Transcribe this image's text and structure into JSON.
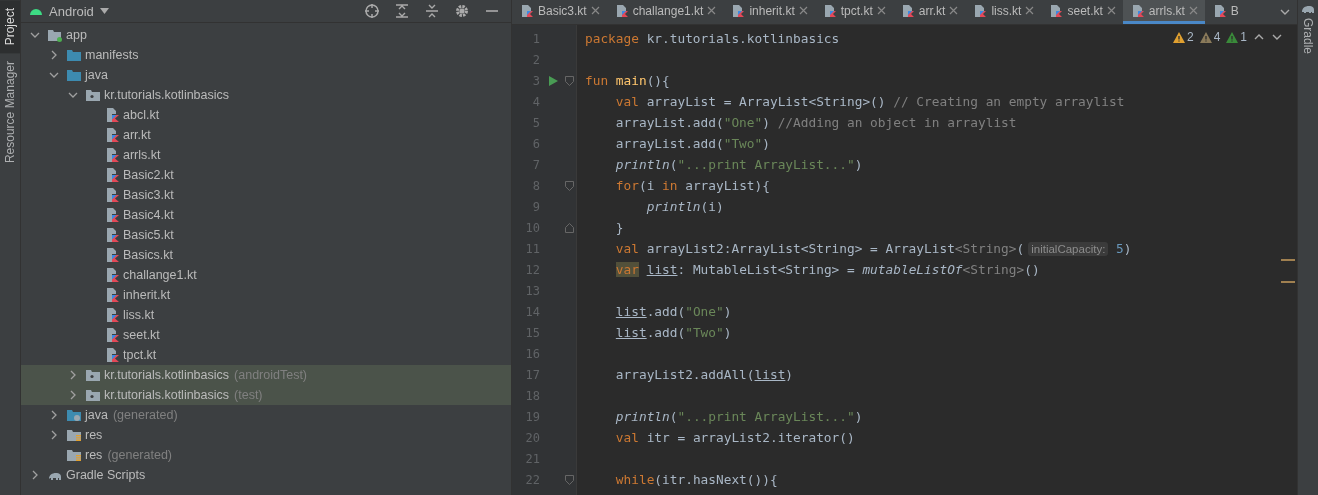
{
  "side_tabs": [
    {
      "label": "Project",
      "selected": true
    },
    {
      "label": "Resource Manager",
      "selected": false
    }
  ],
  "project_panel": {
    "view": "Android"
  },
  "tree": [
    {
      "label": "app",
      "kind": "module",
      "expanded": true,
      "selected": false,
      "children": [
        {
          "label": "manifests",
          "kind": "folder",
          "expanded": false,
          "selected": false
        },
        {
          "label": "java",
          "kind": "folder",
          "expanded": true,
          "selected": false,
          "children": [
            {
              "label": "kr.tutorials.kotlinbasics",
              "kind": "package",
              "expanded": true,
              "selected": false,
              "children": [
                {
                  "label": "abcl.kt",
                  "kind": "kotlin",
                  "selected": false
                },
                {
                  "label": "arr.kt",
                  "kind": "kotlin",
                  "selected": false
                },
                {
                  "label": "arrls.kt",
                  "kind": "kotlin",
                  "selected": false
                },
                {
                  "label": "Basic2.kt",
                  "kind": "kotlin",
                  "selected": false
                },
                {
                  "label": "Basic3.kt",
                  "kind": "kotlin",
                  "selected": false
                },
                {
                  "label": "Basic4.kt",
                  "kind": "kotlin",
                  "selected": false
                },
                {
                  "label": "Basic5.kt",
                  "kind": "kotlin",
                  "selected": false
                },
                {
                  "label": "Basics.kt",
                  "kind": "kotlin",
                  "selected": false
                },
                {
                  "label": "challange1.kt",
                  "kind": "kotlin",
                  "selected": false
                },
                {
                  "label": "inherit.kt",
                  "kind": "kotlin",
                  "selected": false
                },
                {
                  "label": "liss.kt",
                  "kind": "kotlin",
                  "selected": false
                },
                {
                  "label": "seet.kt",
                  "kind": "kotlin",
                  "selected": false
                },
                {
                  "label": "tpct.kt",
                  "kind": "kotlin",
                  "selected": false
                }
              ]
            },
            {
              "label": "kr.tutorials.kotlinbasics",
              "suffix": "(androidTest)",
              "kind": "package",
              "expanded": false,
              "selected": true
            },
            {
              "label": "kr.tutorials.kotlinbasics",
              "suffix": "(test)",
              "kind": "package",
              "expanded": false,
              "selected": true
            }
          ]
        },
        {
          "label": "java",
          "suffix": "(generated)",
          "kind": "generated",
          "expanded": false,
          "selected": false
        },
        {
          "label": "res",
          "kind": "res",
          "expanded": false,
          "selected": false
        },
        {
          "label": "res",
          "suffix": "(generated)",
          "kind": "res",
          "selected": false
        }
      ]
    },
    {
      "label": "Gradle Scripts",
      "kind": "gradle",
      "expanded": false,
      "selected": false
    }
  ],
  "tabs": [
    {
      "label": "Basic3.kt",
      "selected": false,
      "closable": true
    },
    {
      "label": "challange1.kt",
      "selected": false,
      "closable": true
    },
    {
      "label": "inherit.kt",
      "selected": false,
      "closable": true
    },
    {
      "label": "tpct.kt",
      "selected": false,
      "closable": true
    },
    {
      "label": "arr.kt",
      "selected": false,
      "closable": true
    },
    {
      "label": "liss.kt",
      "selected": false,
      "closable": true
    },
    {
      "label": "seet.kt",
      "selected": false,
      "closable": true
    },
    {
      "label": "arrls.kt",
      "selected": true,
      "closable": true
    },
    {
      "label": "B",
      "selected": false,
      "closable": false
    }
  ],
  "inspections": [
    {
      "kind": "warning",
      "count": "2"
    },
    {
      "kind": "weak",
      "count": "4"
    },
    {
      "kind": "ok",
      "count": "1"
    }
  ],
  "right_tabs": [
    {
      "label": "Gradle",
      "selected": false
    }
  ],
  "lines": [
    {
      "number": "1",
      "kind": "code",
      "tokens": [
        {
          "kind": "keyword",
          "text": "package "
        },
        {
          "kind": "plain",
          "text": "kr.tutorials.kotlinbasics"
        }
      ]
    },
    {
      "number": "2",
      "kind": "code"
    },
    {
      "number": "3",
      "kind": "entry",
      "tokens": [
        {
          "kind": "keyword",
          "text": "fun "
        },
        {
          "kind": "function",
          "text": "main"
        },
        {
          "kind": "plain",
          "text": "(){"
        }
      ]
    },
    {
      "number": "4",
      "kind": "code",
      "tokens": [
        {
          "kind": "keyword",
          "text": "    val "
        },
        {
          "kind": "plain",
          "text": "arrayList = ArrayList<String>() "
        },
        {
          "kind": "comment",
          "text": "// Creating an empty arraylist"
        }
      ]
    },
    {
      "number": "5",
      "kind": "code",
      "tokens": [
        {
          "kind": "plain",
          "text": "    arrayList.add("
        },
        {
          "kind": "string",
          "text": "\"One\""
        },
        {
          "kind": "plain",
          "text": ") "
        },
        {
          "kind": "comment",
          "text": "//Adding an object in arraylist"
        }
      ]
    },
    {
      "number": "6",
      "kind": "code",
      "tokens": [
        {
          "kind": "plain",
          "text": "    arrayList.add("
        },
        {
          "kind": "string",
          "text": "\"Two\""
        },
        {
          "kind": "plain",
          "text": ")"
        }
      ]
    },
    {
      "number": "7",
      "kind": "code",
      "tokens": [
        {
          "kind": "call",
          "text": "    println"
        },
        {
          "kind": "plain",
          "text": "("
        },
        {
          "kind": "string",
          "text": "\"...print ArrayList...\""
        },
        {
          "kind": "plain",
          "text": ")"
        }
      ]
    },
    {
      "number": "8",
      "kind": "fold-start",
      "tokens": [
        {
          "kind": "keyword",
          "text": "    for"
        },
        {
          "kind": "plain",
          "text": "(i "
        },
        {
          "kind": "keyword",
          "text": "in "
        },
        {
          "kind": "plain",
          "text": "arrayList){"
        }
      ]
    },
    {
      "number": "9",
      "kind": "code",
      "tokens": [
        {
          "kind": "call",
          "text": "        println"
        },
        {
          "kind": "plain",
          "text": "(i)"
        }
      ]
    },
    {
      "number": "10",
      "kind": "fold-end",
      "tokens": [
        {
          "kind": "plain",
          "text": "    }"
        }
      ]
    },
    {
      "number": "11",
      "kind": "code",
      "tokens": [
        {
          "kind": "keyword",
          "text": "    val "
        },
        {
          "kind": "plain",
          "text": "arrayList2:ArrayList<String> = ArrayList"
        },
        {
          "kind": "type",
          "text": "<String>"
        },
        {
          "kind": "plain",
          "text": "("
        },
        {
          "kind": "hint",
          "text": "initialCapacity:"
        },
        {
          "kind": "number",
          "text": " 5"
        },
        {
          "kind": "plain",
          "text": ")"
        }
      ]
    },
    {
      "number": "12",
      "kind": "code",
      "tokens": [
        {
          "kind": "keyword-marked",
          "text": "    var"
        },
        {
          "kind": "variable",
          "text": " list"
        },
        {
          "kind": "plain",
          "text": ": MutableList<String> = "
        },
        {
          "kind": "call",
          "text": "mutableListOf"
        },
        {
          "kind": "type",
          "text": "<String>"
        },
        {
          "kind": "plain",
          "text": "()"
        }
      ]
    },
    {
      "number": "13",
      "kind": "code"
    },
    {
      "number": "14",
      "kind": "code",
      "tokens": [
        {
          "kind": "variable",
          "text": "    list"
        },
        {
          "kind": "plain",
          "text": ".add("
        },
        {
          "kind": "string",
          "text": "\"One\""
        },
        {
          "kind": "plain",
          "text": ")"
        }
      ]
    },
    {
      "number": "15",
      "kind": "code",
      "tokens": [
        {
          "kind": "variable",
          "text": "    list"
        },
        {
          "kind": "plain",
          "text": ".add("
        },
        {
          "kind": "string",
          "text": "\"Two\""
        },
        {
          "kind": "plain",
          "text": ")"
        }
      ]
    },
    {
      "number": "16",
      "kind": "code"
    },
    {
      "number": "17",
      "kind": "code",
      "tokens": [
        {
          "kind": "plain",
          "text": "    arrayList2.addAll("
        },
        {
          "kind": "variable",
          "text": "list"
        },
        {
          "kind": "plain",
          "text": ")"
        }
      ]
    },
    {
      "number": "18",
      "kind": "code"
    },
    {
      "number": "19",
      "kind": "code",
      "tokens": [
        {
          "kind": "call",
          "text": "    println"
        },
        {
          "kind": "plain",
          "text": "("
        },
        {
          "kind": "string",
          "text": "\"...print ArrayList...\""
        },
        {
          "kind": "plain",
          "text": ")"
        }
      ]
    },
    {
      "number": "20",
      "kind": "code",
      "tokens": [
        {
          "kind": "keyword",
          "text": "    val "
        },
        {
          "kind": "plain",
          "text": "itr = arrayList2.iterator()"
        }
      ]
    },
    {
      "number": "21",
      "kind": "code"
    },
    {
      "number": "22",
      "kind": "fold-start",
      "tokens": [
        {
          "kind": "keyword",
          "text": "    while"
        },
        {
          "kind": "plain",
          "text": "(itr.hasNext()){"
        }
      ]
    }
  ]
}
